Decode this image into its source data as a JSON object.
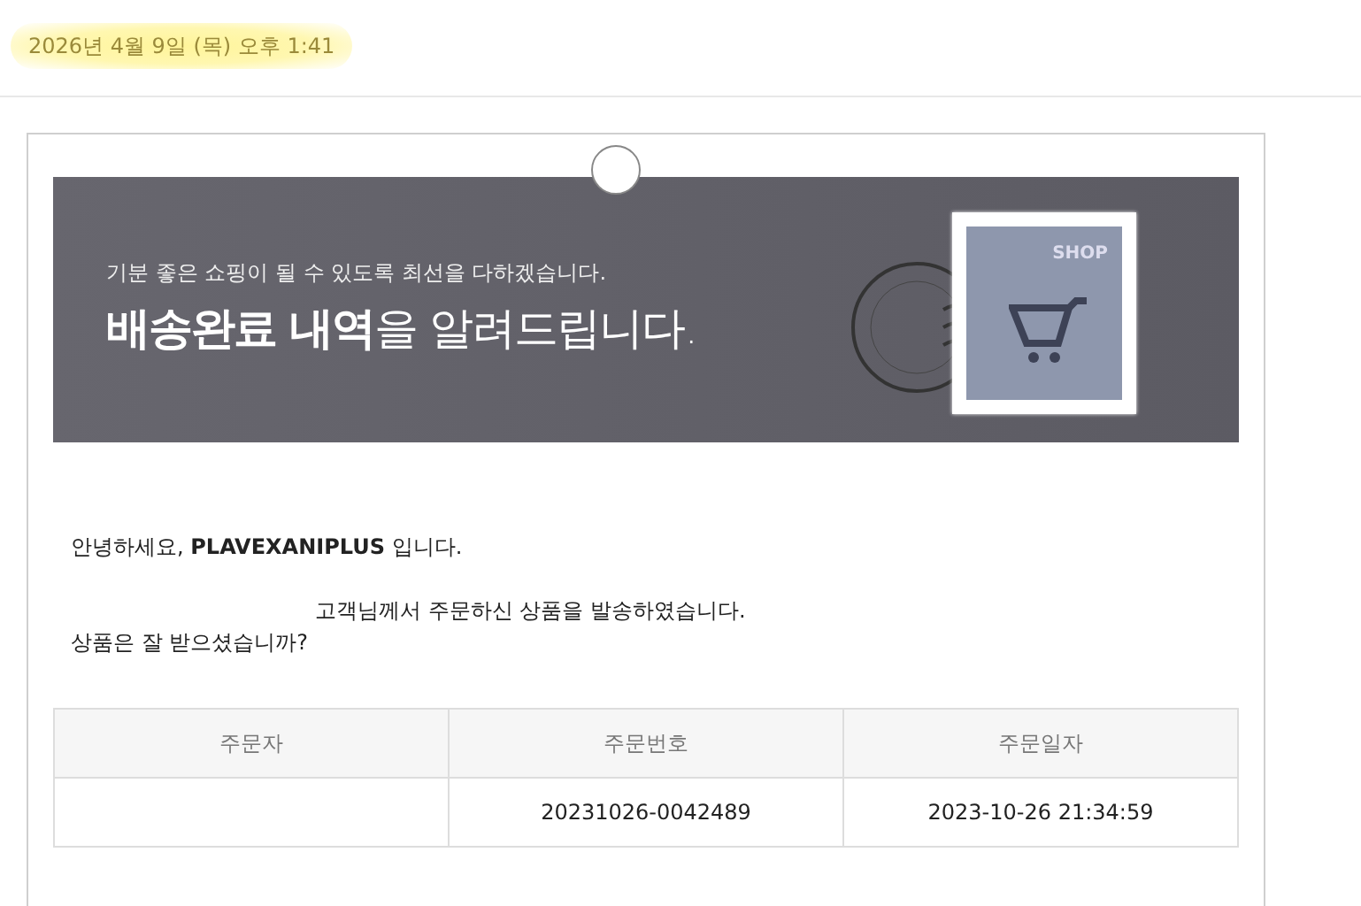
{
  "header": {
    "timestamp": "2026년 4월 9일 (목) 오후 1:41"
  },
  "banner": {
    "subtitle": "기분 좋은 쇼핑이 될 수 있도록 최선을 다하겠습니다.",
    "title": "**배송완료 내역**을 알려드립니다.",
    "stamp_label": "SHOP"
  },
  "message": {
    "greeting": "안녕하세요, **PLAVEXANIPLUS** 입니다.",
    "line_1": "고객님께서 주문하신 상품을 발송하였습니다.",
    "line_2": "상품은 잘 받으셨습니까?"
  },
  "table": {
    "columns": [
      "주문자",
      "주문번호",
      "주문일자"
    ],
    "rows": [
      [
        "",
        "20231026-0042489",
        "2023-10-26 21:34:59"
      ]
    ]
  }
}
